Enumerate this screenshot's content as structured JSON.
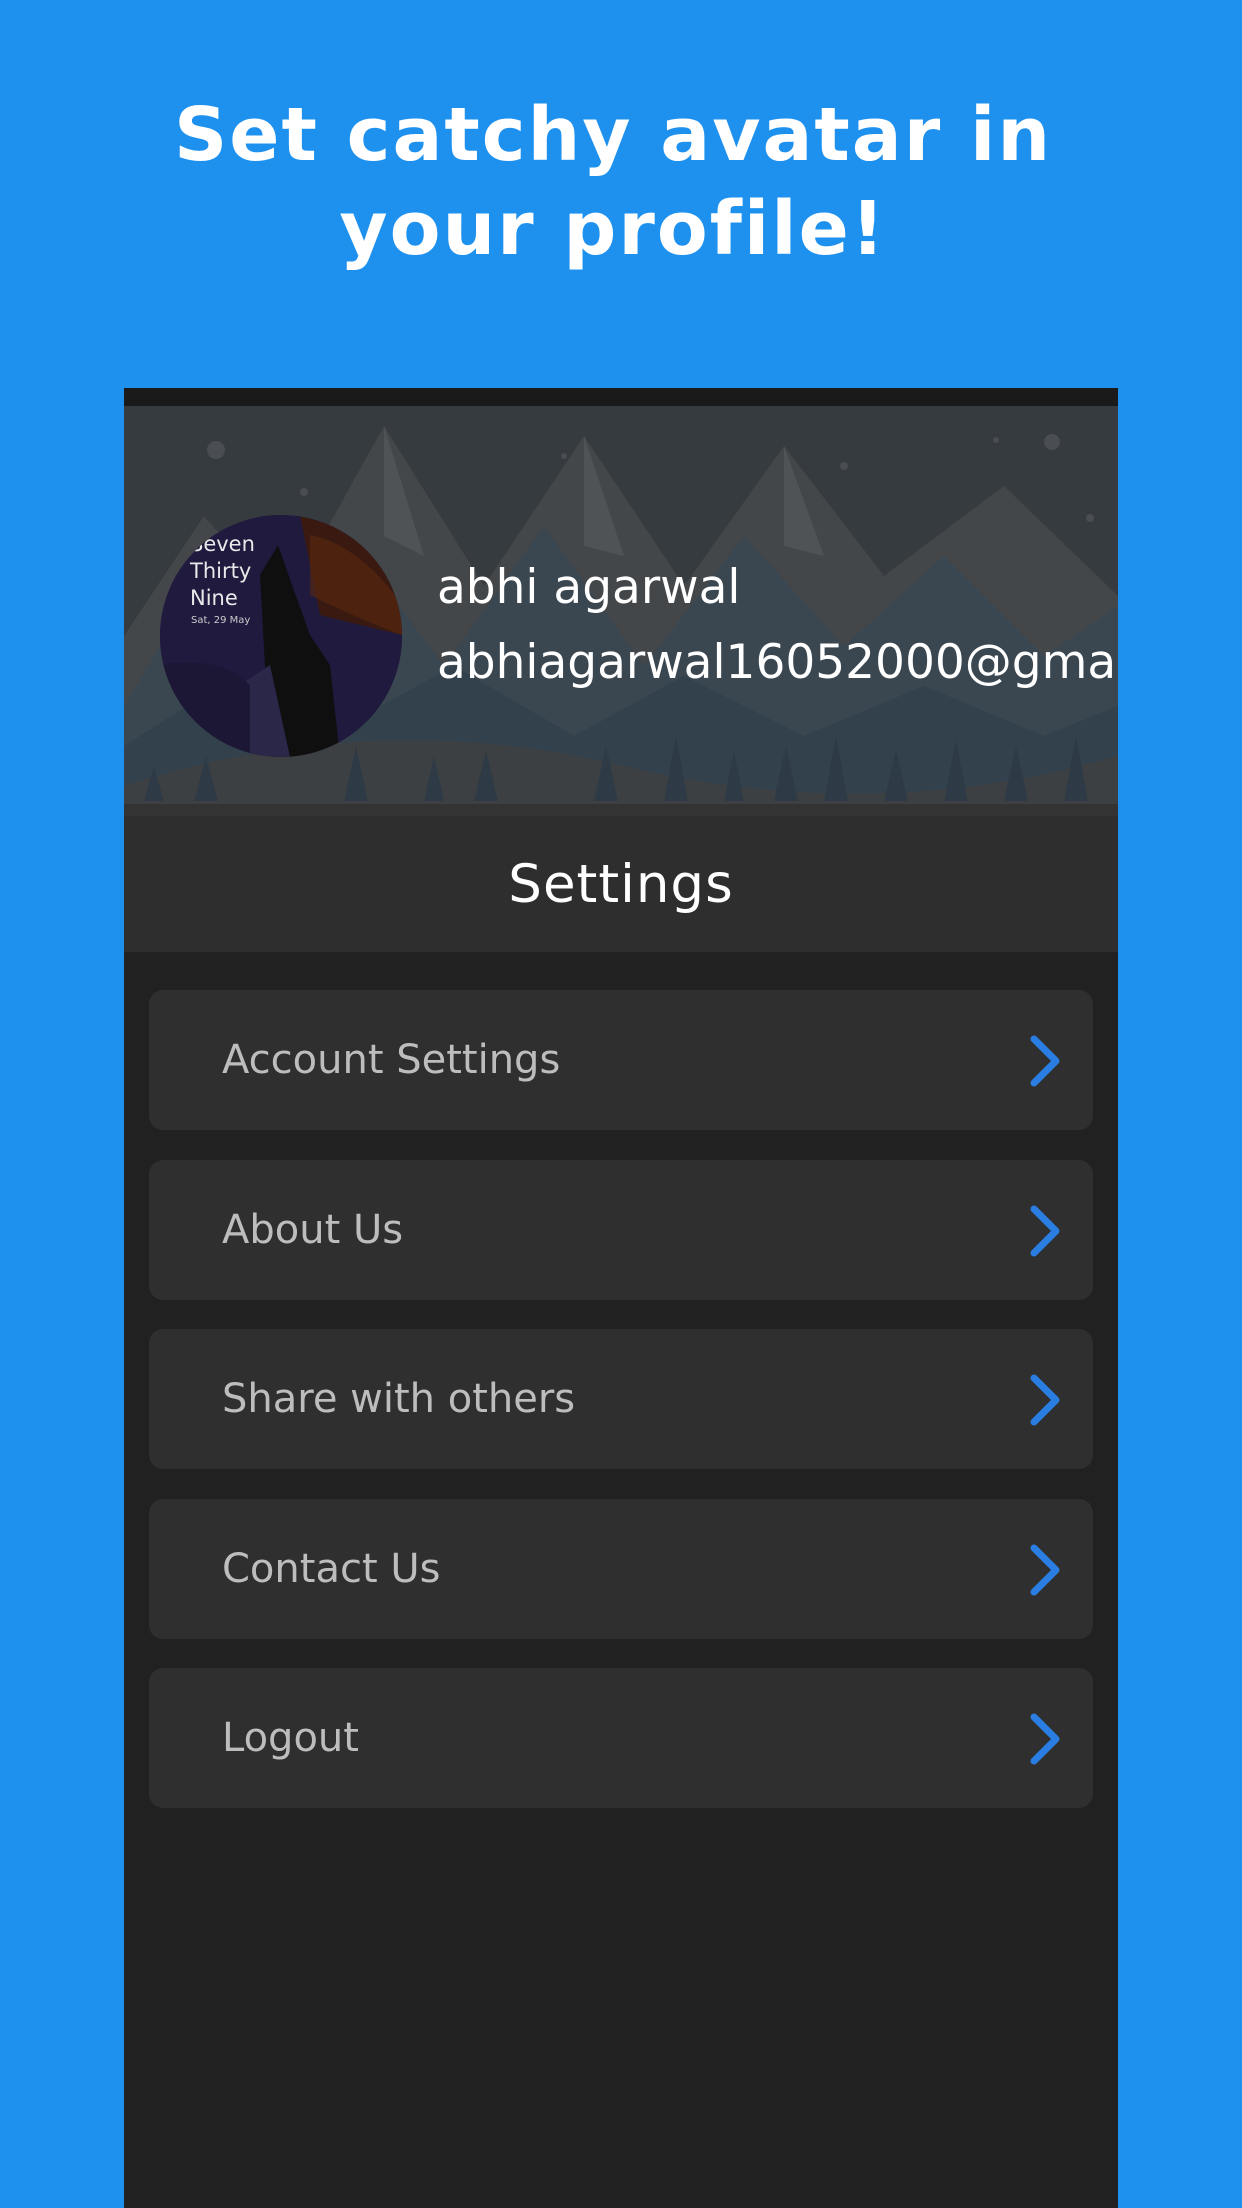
{
  "promo": {
    "title": "Set catchy avatar in your profile!"
  },
  "profile": {
    "avatar_lines": "Seven\nThirty\nNine",
    "avatar_date": "Sat, 29 May",
    "name": "abhi agarwal",
    "email": "abhiagarwal16052000@gma"
  },
  "settings": {
    "title": "Settings",
    "items": [
      {
        "label": "Account Settings",
        "icon": "chevron-right-icon"
      },
      {
        "label": "About Us",
        "icon": "chevron-right-icon"
      },
      {
        "label": "Share with others",
        "icon": "chevron-right-icon"
      },
      {
        "label": "Contact Us",
        "icon": "chevron-right-icon"
      },
      {
        "label": "Logout",
        "icon": "chevron-right-icon"
      }
    ]
  },
  "colors": {
    "background": "#1e91ef",
    "panel": "#212121",
    "card": "#2f2f2f",
    "accent": "#2a7de1",
    "item_text": "#bdbdbd"
  }
}
